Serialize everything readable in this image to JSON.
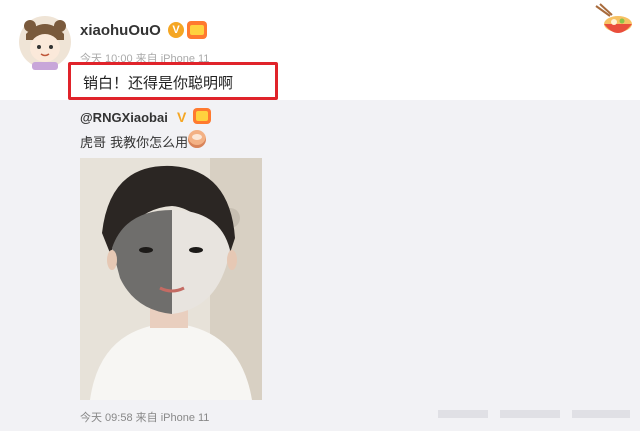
{
  "post": {
    "username": "xiaohuOuO",
    "verified_badge": "V",
    "meta": "今天 10:00 来自 iPhone 11",
    "text": "销白！还得是你聪明啊"
  },
  "repost": {
    "username": "@RNGXiaobai",
    "verified_badge": "V",
    "text": "虎哥 我教你怎么用",
    "meta": "今天 09:58 来自 iPhone 11"
  },
  "colors": {
    "highlight_border": "#e0232a",
    "verified": "#f5a623",
    "repost_bg": "#f2f2f5"
  },
  "icons": [
    "avatar",
    "verified-icon",
    "vip-badge-icon",
    "food-bowl-icon",
    "emoji-icon"
  ]
}
